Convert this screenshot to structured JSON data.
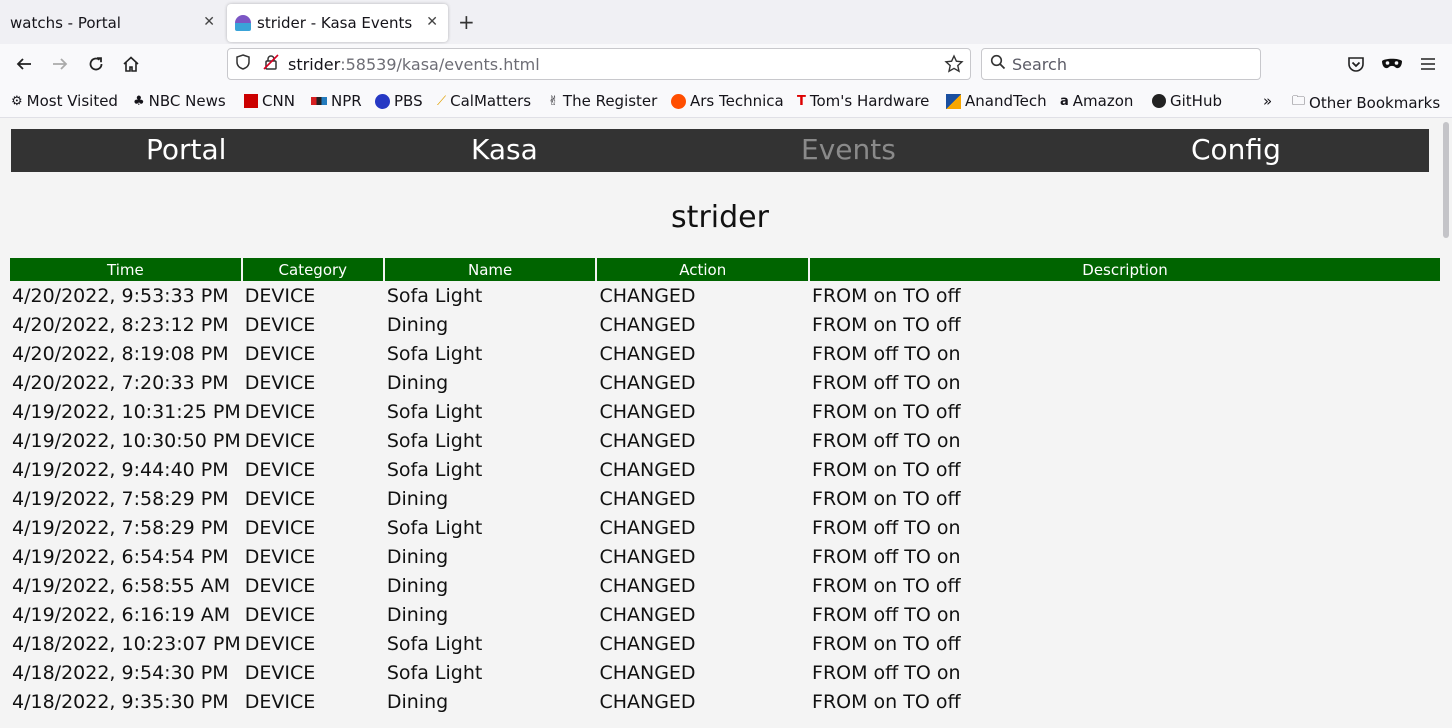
{
  "browser": {
    "tabs": [
      {
        "title": "watchs - Portal",
        "active": false
      },
      {
        "title": "strider - Kasa Events",
        "active": true
      }
    ],
    "new_tab_icon": "plus-icon",
    "url": {
      "host": "strider",
      "path": ":58539/kasa/events.html"
    },
    "search_placeholder": "Search",
    "bookmarks": [
      {
        "label": "Most Visited",
        "icon": "gear-icon"
      },
      {
        "label": "NBC News",
        "icon": "peacock-icon"
      },
      {
        "label": "CNN",
        "icon": "cnn-icon"
      },
      {
        "label": "NPR",
        "icon": "npr-icon"
      },
      {
        "label": "PBS",
        "icon": "pbs-icon"
      },
      {
        "label": "CalMatters",
        "icon": "calmatters-icon"
      },
      {
        "label": "The Register",
        "icon": "register-icon"
      },
      {
        "label": "Ars Technica",
        "icon": "ars-icon"
      },
      {
        "label": "Tom's Hardware",
        "icon": "toms-icon"
      },
      {
        "label": "AnandTech",
        "icon": "anandtech-icon"
      },
      {
        "label": "Amazon",
        "icon": "amazon-icon"
      },
      {
        "label": "GitHub",
        "icon": "github-icon"
      }
    ],
    "other_bookmarks": "Other Bookmarks"
  },
  "site_nav": [
    "Portal",
    "Kasa",
    "Events",
    "Config"
  ],
  "current_nav": "Events",
  "page_title": "strider",
  "table": {
    "headers": [
      "Time",
      "Category",
      "Name",
      "Action",
      "Description"
    ],
    "rows": [
      [
        "4/20/2022, 9:53:33 PM",
        "DEVICE",
        "Sofa Light",
        "CHANGED",
        "FROM on TO off"
      ],
      [
        "4/20/2022, 8:23:12 PM",
        "DEVICE",
        "Dining",
        "CHANGED",
        "FROM on TO off"
      ],
      [
        "4/20/2022, 8:19:08 PM",
        "DEVICE",
        "Sofa Light",
        "CHANGED",
        "FROM off TO on"
      ],
      [
        "4/20/2022, 7:20:33 PM",
        "DEVICE",
        "Dining",
        "CHANGED",
        "FROM off TO on"
      ],
      [
        "4/19/2022, 10:31:25 PM",
        "DEVICE",
        "Sofa Light",
        "CHANGED",
        "FROM on TO off"
      ],
      [
        "4/19/2022, 10:30:50 PM",
        "DEVICE",
        "Sofa Light",
        "CHANGED",
        "FROM off TO on"
      ],
      [
        "4/19/2022, 9:44:40 PM",
        "DEVICE",
        "Sofa Light",
        "CHANGED",
        "FROM on TO off"
      ],
      [
        "4/19/2022, 7:58:29 PM",
        "DEVICE",
        "Dining",
        "CHANGED",
        "FROM on TO off"
      ],
      [
        "4/19/2022, 7:58:29 PM",
        "DEVICE",
        "Sofa Light",
        "CHANGED",
        "FROM off TO on"
      ],
      [
        "4/19/2022, 6:54:54 PM",
        "DEVICE",
        "Dining",
        "CHANGED",
        "FROM off TO on"
      ],
      [
        "4/19/2022, 6:58:55 AM",
        "DEVICE",
        "Dining",
        "CHANGED",
        "FROM on TO off"
      ],
      [
        "4/19/2022, 6:16:19 AM",
        "DEVICE",
        "Dining",
        "CHANGED",
        "FROM off TO on"
      ],
      [
        "4/18/2022, 10:23:07 PM",
        "DEVICE",
        "Sofa Light",
        "CHANGED",
        "FROM on TO off"
      ],
      [
        "4/18/2022, 9:54:30 PM",
        "DEVICE",
        "Sofa Light",
        "CHANGED",
        "FROM off TO on"
      ],
      [
        "4/18/2022, 9:35:30 PM",
        "DEVICE",
        "Dining",
        "CHANGED",
        "FROM on TO off"
      ]
    ]
  }
}
